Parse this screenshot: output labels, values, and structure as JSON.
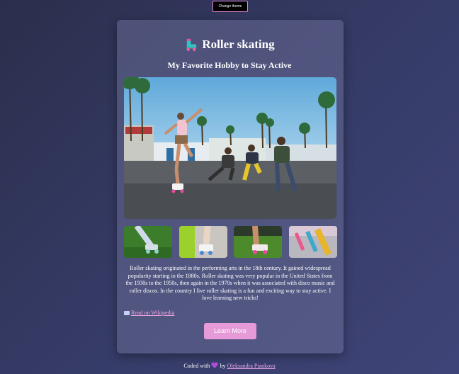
{
  "theme_button": {
    "label": "Change theme"
  },
  "header": {
    "icon": "roller-skate-icon",
    "title": "Roller skating",
    "subtitle": "My Favorite Hobby to Stay Active"
  },
  "gallery": {
    "hero_icon": "photo-skaters-boardwalk",
    "thumbnails": [
      {
        "icon": "photo-skates-grass-1"
      },
      {
        "icon": "photo-skates-lime"
      },
      {
        "icon": "photo-skates-grass-2"
      },
      {
        "icon": "photo-skates-rainbow"
      }
    ]
  },
  "description": "Roller skating originated in the performing arts in the 18th century. It gained widespread popularity starting in the 1880s. Roller skating was very popular in the United States from the 1930s to the 1950s, then again in the 1970s when it was associated with disco music and roller discos. In the country I live roller skating is a fun and exciting way to stay active. I love learning new tricks!",
  "wiki_link": {
    "icon": "book-icon",
    "label": "Read on Wikipedia"
  },
  "learn_more": {
    "label": "Learn More"
  },
  "footer": {
    "prefix": "Coded with",
    "heart_icon": "purple-heart-icon",
    "by": "by",
    "author": "Oleksandra Piankova"
  },
  "colors": {
    "accent": "#e69ad8",
    "link": "#f0a6e6",
    "background": "#333861"
  }
}
